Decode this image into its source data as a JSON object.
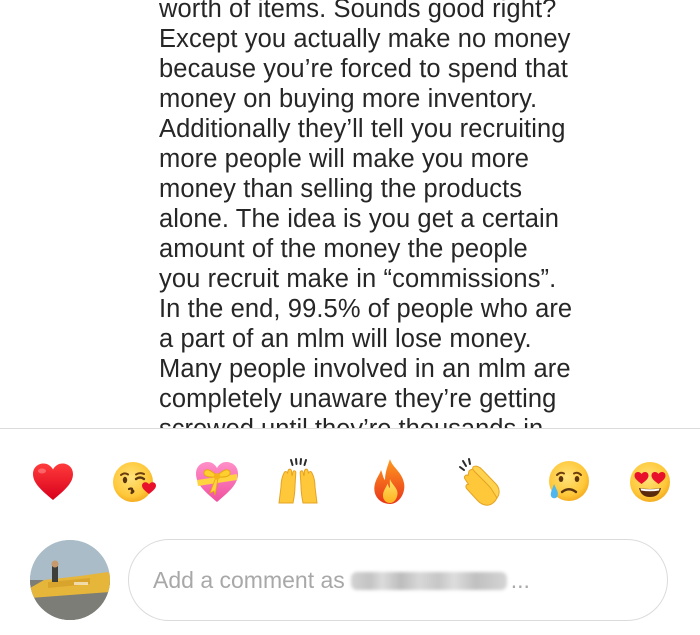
{
  "comment": {
    "lines": [
      "worth of items. Sounds good right?",
      "Except you actually make no money",
      "because you’re forced to spend that",
      "money on buying more inventory.",
      "Additionally they’ll tell you recruiting",
      "more people will make you more",
      "money than selling the products",
      "alone. The idea is you get a certain",
      "amount of the money the people",
      "you recruit make in “commissions”.",
      "In the end, 99.5% of people who are",
      "a part of an mlm will lose money.",
      "Many people involved in an mlm are",
      "completely unaware they’re getting"
    ],
    "cut_off_line": "screwed until they’re thousands in"
  },
  "emoji_reactions": [
    {
      "name": "red-heart",
      "glyph": "❤️"
    },
    {
      "name": "face-blowing-kiss",
      "glyph": "😘"
    },
    {
      "name": "heart-with-ribbon",
      "glyph": "💝"
    },
    {
      "name": "raising-hands",
      "glyph": "🙌"
    },
    {
      "name": "fire",
      "glyph": "🔥"
    },
    {
      "name": "clapping-hands",
      "glyph": "👏"
    },
    {
      "name": "crying-face",
      "glyph": "😢"
    },
    {
      "name": "heart-eyes",
      "glyph": "😍"
    }
  ],
  "composer": {
    "placeholder_prefix": "Add a comment as",
    "placeholder_suffix": "..."
  },
  "colors": {
    "text": "#262626",
    "placeholder": "#a8a8a8",
    "divider": "#dbdbdb"
  }
}
